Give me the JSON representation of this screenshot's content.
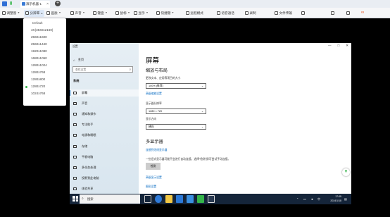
{
  "tabbar": {
    "tab_title": "演示机器-1",
    "tab_close": "×",
    "add_tab": "+"
  },
  "toolbar": {
    "items": [
      {
        "label": "调整窗",
        "icon": "window-icon"
      },
      {
        "label": "分辨率",
        "icon": "resolution-icon"
      },
      {
        "label": "画质",
        "icon": "quality-icon"
      },
      {
        "label": "声音",
        "icon": "sound-icon"
      },
      {
        "label": "键盘",
        "icon": "keyboard-icon"
      },
      {
        "label": "鼠标",
        "icon": "mouse-icon"
      },
      {
        "label": "显示",
        "icon": "display-icon"
      },
      {
        "label": "快捷键",
        "icon": "shortcut-icon"
      },
      {
        "label": "远程模式",
        "icon": "remote-mode-icon"
      },
      {
        "label": "语音通话",
        "icon": "voice-call-icon"
      },
      {
        "label": "录制",
        "icon": "record-icon"
      },
      {
        "label": "文件传输",
        "icon": "file-transfer-icon"
      }
    ]
  },
  "resolution_menu": {
    "default_label": "Default",
    "options": [
      "4K(3840x2160)",
      "2560x1600",
      "2560x1440",
      "1920x1080",
      "1680x1050",
      "1280x1024",
      "1280x768",
      "1280x800",
      "1280x720",
      "1024x768"
    ],
    "selected": "1280x720"
  },
  "settings": {
    "window_title": "设置",
    "controls": [
      "—",
      "□",
      "✕"
    ],
    "home": "主页",
    "search_placeholder": "查找设置",
    "system_label": "系统",
    "nav": [
      "屏幕",
      "声音",
      "通知和操作",
      "专注助手",
      "电源和睡眠",
      "存储",
      "平板电脑",
      "多任务处理",
      "投影到此电脑",
      "体验共享"
    ],
    "active_nav": "屏幕",
    "page_title": "屏幕",
    "scale_heading": "缩放与布局",
    "scale_desc": "更改文本、应用等项目的大小",
    "scale_value": "100% (推荐)",
    "advanced_scale_link": "高级缩放设置",
    "resolution_label": "显示器分辨率",
    "resolution_value": "1280 × 720",
    "orientation_label": "显示方向",
    "orientation_value": "横向",
    "multi_heading": "多显示器",
    "wireless_link": "连接到无线显示器",
    "detect_desc": "一些旧式显示器可能不会进行自动连接。选择“检测”即可尝试手动连接。",
    "detect_button": "检测",
    "advanced_display_link": "高级显示设置",
    "graphics_link": "图形设置"
  },
  "taskbar": {
    "search_label": "搜索",
    "time": "17:05",
    "date": "2024/1/18"
  },
  "colors": {
    "accent": "#0067c0",
    "selected_dot": "#35b54a",
    "taskbar_bg": "#15253a"
  }
}
